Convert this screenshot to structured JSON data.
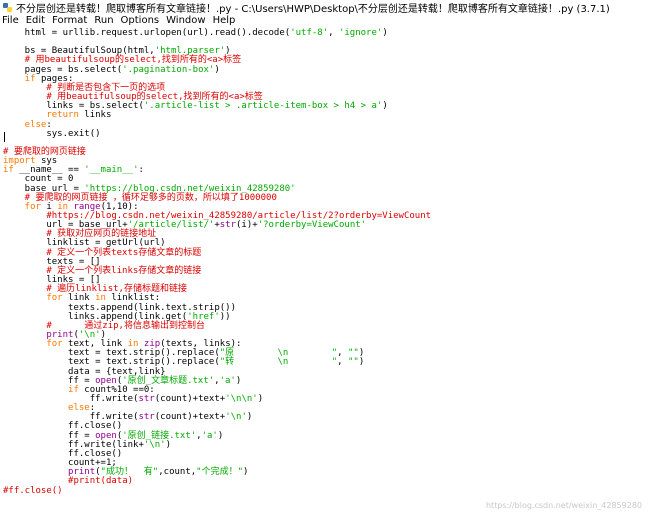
{
  "window": {
    "title": "不分层创还是转载！爬取博客所有文章链接！.py - C:\\Users\\HWP\\Desktop\\不分层创还是转载！爬取博客所有文章链接！.py (3.7.1)"
  },
  "menu": {
    "items": [
      "File",
      "Edit",
      "Format",
      "Run",
      "Options",
      "Window",
      "Help"
    ]
  },
  "colors": {
    "default": "#000000",
    "comment": "#dd0000",
    "keyword": "#ff7700",
    "string": "#00aa00",
    "builtin": "#900090"
  },
  "code": {
    "lines": [
      [
        [
          "default",
          "    html = urllib.request.urlopen(url).read().decode("
        ],
        [
          "string",
          "'utf-8'"
        ],
        [
          "default",
          ", "
        ],
        [
          "string",
          "'ignore'"
        ],
        [
          "default",
          ")"
        ]
      ],
      [],
      [
        [
          "default",
          "    bs = BeautifulSoup(html,"
        ],
        [
          "string",
          "'html.parser'"
        ],
        [
          "default",
          ")"
        ]
      ],
      [
        [
          "comment",
          "    # 用beautifulsoup的select,找到所有的<a>标签"
        ]
      ],
      [
        [
          "default",
          "    pages = bs.select("
        ],
        [
          "string",
          "'.pagination-box'"
        ],
        [
          "default",
          ")"
        ]
      ],
      [
        [
          "keyword",
          "    if "
        ],
        [
          "default",
          "pages:"
        ]
      ],
      [
        [
          "comment",
          "        # 判断是否包含下一页的选项"
        ]
      ],
      [
        [
          "comment",
          "        # 用beautifulsoup的select,找到所有的<a>标签"
        ]
      ],
      [
        [
          "default",
          "        links = bs.select("
        ],
        [
          "string",
          "'.article-list > .article-item-box > h4 > a'"
        ],
        [
          "default",
          ")"
        ]
      ],
      [
        [
          "keyword",
          "        return "
        ],
        [
          "default",
          "links"
        ]
      ],
      [
        [
          "keyword",
          "    else"
        ],
        [
          "default",
          ":"
        ]
      ],
      [
        [
          "default",
          "        sys.exit()"
        ]
      ],
      [],
      [
        [
          "comment",
          "# 要爬取的网页链接"
        ]
      ],
      [
        [
          "keyword",
          "import "
        ],
        [
          "default",
          "sys"
        ]
      ],
      [
        [
          "keyword",
          "if "
        ],
        [
          "default",
          "__name__ == "
        ],
        [
          "string",
          "'__main__'"
        ],
        [
          "default",
          ":"
        ]
      ],
      [
        [
          "default",
          "    count = 0"
        ]
      ],
      [
        [
          "default",
          "    base_url = "
        ],
        [
          "string",
          "'https://blog.csdn.net/weixin_42859280'"
        ]
      ],
      [
        [
          "comment",
          "    # 要爬取的网页链接 ，循环足够多的页数，所以填了1000000"
        ]
      ],
      [
        [
          "keyword",
          "    for "
        ],
        [
          "default",
          "i "
        ],
        [
          "keyword",
          "in "
        ],
        [
          "builtin",
          "range"
        ],
        [
          "default",
          "(1,10):"
        ]
      ],
      [
        [
          "comment",
          "        #https://blog.csdn.net/weixin_42859280/article/list/2?orderby=ViewCount"
        ]
      ],
      [
        [
          "default",
          "        url = base_url+"
        ],
        [
          "string",
          "'/article/list/'"
        ],
        [
          "default",
          "+"
        ],
        [
          "builtin",
          "str"
        ],
        [
          "default",
          "(i)+"
        ],
        [
          "string",
          "'?orderby=ViewCount'"
        ]
      ],
      [
        [
          "comment",
          "        # 获取对应网页的链接地址"
        ]
      ],
      [
        [
          "default",
          "        linklist = getUrl(url)"
        ]
      ],
      [
        [
          "comment",
          "        # 定义一个列表texts存储文章的标题"
        ]
      ],
      [
        [
          "default",
          "        texts = []"
        ]
      ],
      [
        [
          "comment",
          "        # 定义一个列表links存储文章的链接"
        ]
      ],
      [
        [
          "default",
          "        links = []"
        ]
      ],
      [
        [
          "comment",
          "        # 遍历linklist,存储标题和链接"
        ]
      ],
      [
        [
          "keyword",
          "        for "
        ],
        [
          "default",
          "link "
        ],
        [
          "keyword",
          "in "
        ],
        [
          "default",
          "linklist:"
        ]
      ],
      [
        [
          "default",
          "            texts.append(link.text.strip())"
        ]
      ],
      [
        [
          "default",
          "            links.append(link.get("
        ],
        [
          "string",
          "'href'"
        ],
        [
          "default",
          "))"
        ]
      ],
      [
        [
          "comment",
          "        #      通过zip,将信息输出到控制台"
        ]
      ],
      [
        [
          "builtin",
          "        print"
        ],
        [
          "default",
          "("
        ],
        [
          "string",
          "'\\n'"
        ],
        [
          "default",
          ")"
        ]
      ],
      [
        [
          "keyword",
          "        for "
        ],
        [
          "default",
          "text, link "
        ],
        [
          "keyword",
          "in "
        ],
        [
          "builtin",
          "zip"
        ],
        [
          "default",
          "(texts, links):"
        ]
      ],
      [
        [
          "default",
          "            text = text.strip().replace("
        ],
        [
          "string",
          "\"原        \\n        \""
        ],
        [
          "default",
          ", "
        ],
        [
          "string",
          "\"\""
        ],
        [
          "default",
          ")"
        ]
      ],
      [
        [
          "default",
          "            text = text.strip().replace("
        ],
        [
          "string",
          "\"转        \\n        \""
        ],
        [
          "default",
          ", "
        ],
        [
          "string",
          "\"\""
        ],
        [
          "default",
          ")"
        ]
      ],
      [
        [
          "default",
          "            data = {text,link}"
        ]
      ],
      [
        [
          "default",
          "            ff = "
        ],
        [
          "builtin",
          "open"
        ],
        [
          "default",
          "("
        ],
        [
          "string",
          "'原创_文章标题.txt'"
        ],
        [
          "default",
          ","
        ],
        [
          "string",
          "'a'"
        ],
        [
          "default",
          ")"
        ]
      ],
      [
        [
          "keyword",
          "            if "
        ],
        [
          "default",
          "count%10 ==0:"
        ]
      ],
      [
        [
          "default",
          "                ff.write("
        ],
        [
          "builtin",
          "str"
        ],
        [
          "default",
          "(count)+text+"
        ],
        [
          "string",
          "'\\n\\n'"
        ],
        [
          "default",
          ")"
        ]
      ],
      [
        [
          "keyword",
          "            else"
        ],
        [
          "default",
          ":"
        ]
      ],
      [
        [
          "default",
          "                ff.write("
        ],
        [
          "builtin",
          "str"
        ],
        [
          "default",
          "(count)+text+"
        ],
        [
          "string",
          "'\\n'"
        ],
        [
          "default",
          ")"
        ]
      ],
      [
        [
          "default",
          "            ff.close()"
        ]
      ],
      [
        [
          "default",
          "            ff = "
        ],
        [
          "builtin",
          "open"
        ],
        [
          "default",
          "("
        ],
        [
          "string",
          "'原创_链接.txt'"
        ],
        [
          "default",
          ","
        ],
        [
          "string",
          "'a'"
        ],
        [
          "default",
          ")"
        ]
      ],
      [
        [
          "default",
          "            ff.write(link+"
        ],
        [
          "string",
          "'\\n'"
        ],
        [
          "default",
          ")"
        ]
      ],
      [
        [
          "default",
          "            ff.close()"
        ]
      ],
      [
        [
          "default",
          "            count+=1;"
        ]
      ],
      [
        [
          "builtin",
          "            print"
        ],
        [
          "default",
          "("
        ],
        [
          "string",
          "\"成功！  有\""
        ],
        [
          "default",
          ",count,"
        ],
        [
          "string",
          "\"个完成！\""
        ],
        [
          "default",
          ")"
        ]
      ],
      [
        [
          "comment",
          "            #print(data)"
        ]
      ],
      [
        [
          "comment",
          "#ff.close()"
        ]
      ]
    ]
  },
  "watermark": "https://blog.csdn.net/weixin_42859280"
}
